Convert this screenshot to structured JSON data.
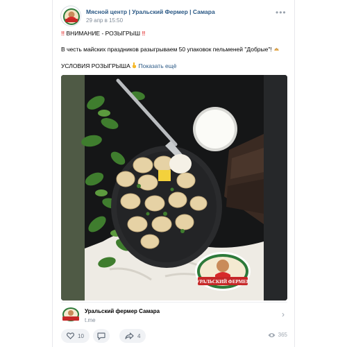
{
  "post": {
    "author": "Мясной центр | Уральский Фермер | Самара",
    "date": "29 апр в 15:50",
    "headline": "ВНИМАНИЕ - РОЗЫГРЫШ",
    "body": "В честь майских праздников разыгрываем 50 упаковок пельменей \"Добрые\"!",
    "conditions": "УСЛОВИЯ РОЗЫГРЫША",
    "show_more": "Показать ещё"
  },
  "photo": {
    "brand_logo_text": "УРАЛЬСКИЙ ФЕРМЕР"
  },
  "link_card": {
    "title": "Уральский фермер Самара",
    "url": "t.me"
  },
  "actions": {
    "likes": "10",
    "reposts": "4",
    "views": "365"
  },
  "colors": {
    "link": "#2a5885",
    "alert": "#e64646",
    "pill_bg": "#f0f2f5"
  },
  "icons": [
    "avatar-logo",
    "more-icon",
    "double-exclamation-icon",
    "pierogi-icon",
    "pointing-down-icon",
    "heart-icon",
    "comment-icon",
    "share-icon",
    "eye-icon",
    "chevron-right-icon"
  ]
}
